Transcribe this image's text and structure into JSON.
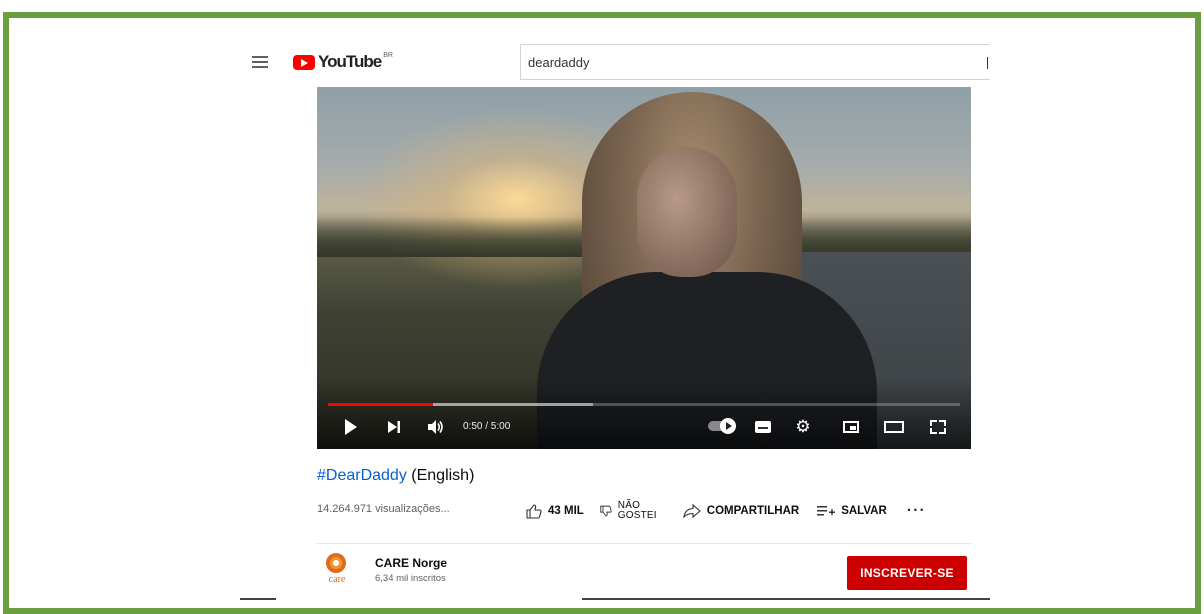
{
  "header": {
    "logo_text": "YouTube",
    "country_code": "BR",
    "search_value": "deardaddy"
  },
  "player": {
    "current_time": "0:50",
    "duration": "5:00",
    "time_display": "0:50 / 5:00",
    "progress_fraction": 0.1667,
    "buffer_fraction": 0.42
  },
  "video": {
    "title_hashtag": "#DearDaddy",
    "title_rest": " (English)",
    "views": "14.264.971 visualizações...",
    "like_count": "43 MIL",
    "dislike_label_line1": "NÃO",
    "dislike_label_line2": "GOSTEI",
    "share_label": "COMPARTILHAR",
    "save_label": "SALVAR",
    "more_label": "···"
  },
  "channel": {
    "name": "CARE Norge",
    "subscribers": "6,34 mil inscritos",
    "logo_text": "care",
    "subscribe_label": "INSCREVER-SE"
  },
  "colors": {
    "frame_border": "#6a9e3f",
    "youtube_red": "#ff0000",
    "subscribe_bg": "#cc0000",
    "link_blue": "#065fd4"
  },
  "icons": {
    "menu": "hamburger-icon",
    "like": "thumbs-up-icon",
    "dislike": "thumbs-down-icon",
    "share": "share-arrow-icon",
    "save": "playlist-add-icon",
    "more": "more-horizontal-icon"
  }
}
